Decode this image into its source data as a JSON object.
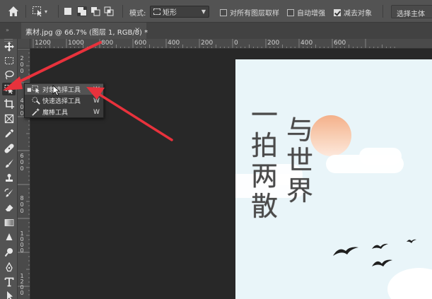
{
  "options_bar": {
    "mode_label": "模式:",
    "mode_value": "矩形",
    "sample_all_layers": {
      "label": "对所有图层取样",
      "checked": false
    },
    "auto_enhance": {
      "label": "自动增强",
      "checked": false
    },
    "subtract_object": {
      "label": "减去对象",
      "checked": true
    },
    "select_subject_label": "选择主体"
  },
  "document_tab": {
    "title": "素材.jpg @ 66.7% (图层 1, RGB/8) *",
    "close_glyph": "×"
  },
  "rulers": {
    "horizontal_labels": [
      "1200",
      "1000",
      "800",
      "600",
      "400",
      "200",
      "0",
      "200",
      "400",
      "600"
    ],
    "vertical_labels": [
      "2",
      "0",
      "0",
      "4",
      "0",
      "0",
      "6",
      "0",
      "0",
      "8",
      "0",
      "0",
      "1000",
      "1200"
    ]
  },
  "tool_flyout": {
    "items": [
      {
        "label": "对象选择工具",
        "shortcut": "W",
        "icon": "object-selection-icon",
        "selected": true
      },
      {
        "label": "快速选择工具",
        "shortcut": "W",
        "icon": "quick-selection-icon",
        "selected": false
      },
      {
        "label": "魔棒工具",
        "shortcut": "W",
        "icon": "magic-wand-icon",
        "selected": false
      }
    ]
  },
  "canvas_text": {
    "column_left": [
      "一",
      "拍",
      "两",
      "散"
    ],
    "column_right": [
      "与",
      "世",
      "界"
    ]
  },
  "colors": {
    "annotation_arrow": "#e8323c",
    "panel_bg": "#535353",
    "workspace_bg": "#282828",
    "artwork_sky": "#e9f5f9",
    "sun": "#f4b08a"
  },
  "icons": [
    "home-icon",
    "move-icon",
    "rectangular-marquee-icon",
    "lasso-icon",
    "object-selection-icon",
    "crop-icon",
    "frame-icon",
    "eyedropper-icon",
    "healing-brush-icon",
    "brush-icon",
    "clone-stamp-icon",
    "history-brush-icon",
    "eraser-icon",
    "gradient-icon",
    "blur-icon",
    "dodge-icon",
    "pen-icon",
    "type-icon",
    "path-selection-icon"
  ]
}
